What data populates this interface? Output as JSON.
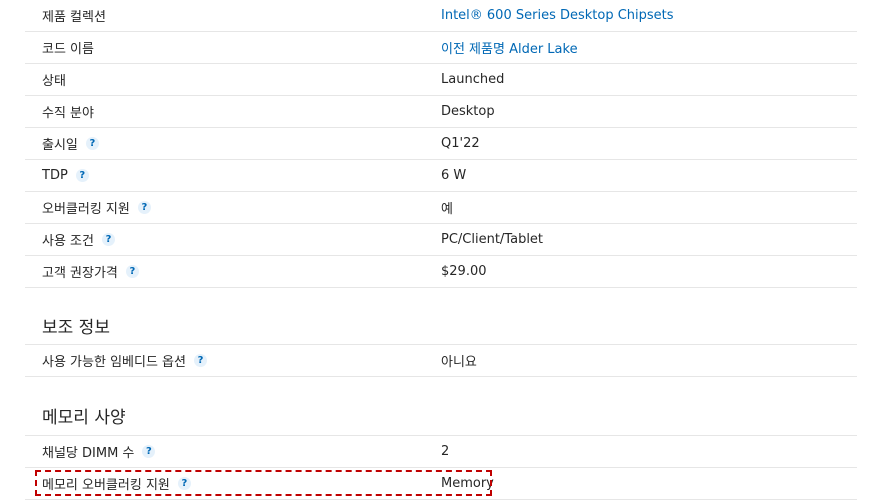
{
  "spec_rows": [
    {
      "label": "제품 컬렉션",
      "value": "Intel® 600 Series Desktop Chipsets",
      "link": true,
      "help": false
    },
    {
      "label": "코드 이름",
      "value": "이전 제품명 Alder Lake",
      "link": true,
      "help": false
    },
    {
      "label": "상태",
      "value": "Launched",
      "link": false,
      "help": false
    },
    {
      "label": "수직 분야",
      "value": "Desktop",
      "link": false,
      "help": false
    },
    {
      "label": "출시일",
      "value": "Q1'22",
      "link": false,
      "help": true
    },
    {
      "label": "TDP",
      "value": "6 W",
      "link": false,
      "help": true
    },
    {
      "label": "오버클러킹 지원",
      "value": "예",
      "link": false,
      "help": true
    },
    {
      "label": "사용 조건",
      "value": "PC/Client/Tablet",
      "link": false,
      "help": true
    },
    {
      "label": "고객 권장가격",
      "value": "$29.00",
      "link": false,
      "help": true
    }
  ],
  "section_aux": {
    "title": "보조 정보",
    "rows": [
      {
        "label": "사용 가능한 임베디드 옵션",
        "value": "아니요",
        "help": true
      }
    ]
  },
  "section_memory": {
    "title": "메모리 사양",
    "rows": [
      {
        "label": "채널당 DIMM 수",
        "value": "2",
        "help": true
      },
      {
        "label": "메모리 오버클러킹 지원",
        "value": "Memory",
        "help": true
      }
    ]
  },
  "help_glyph": "?",
  "colors": {
    "link": "#0068b5",
    "highlight_border": "#c00000",
    "divider": "#e6e6e6"
  }
}
